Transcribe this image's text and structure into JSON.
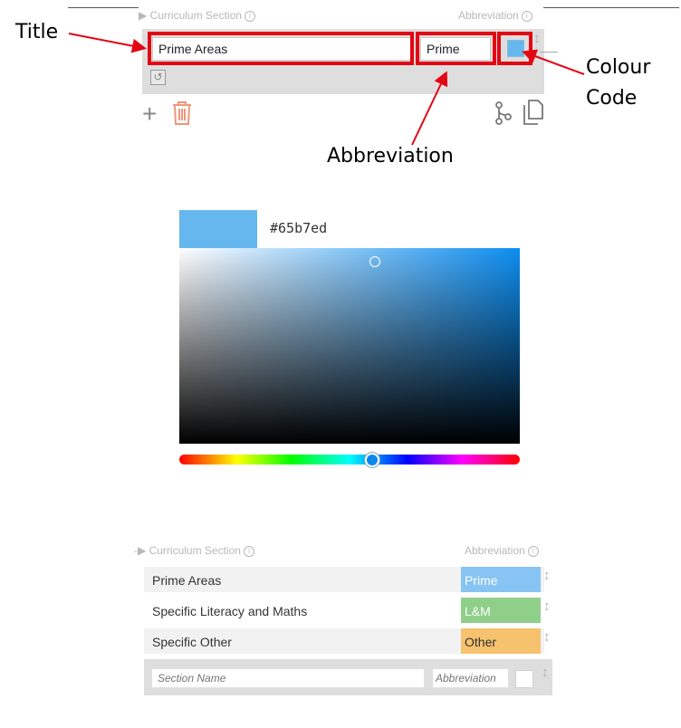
{
  "annotations": {
    "title": "Title",
    "abbreviation": "Abbreviation",
    "colour_code_line1": "Colour",
    "colour_code_line2": "Code"
  },
  "editor": {
    "section_header": "Curriculum Section",
    "abbr_header": "Abbreviation",
    "title_value": "Prime Areas",
    "abbr_value": "Prime",
    "colour": "#65b7ed"
  },
  "picker": {
    "hex": "#65b7ed",
    "hue_position": 0.57
  },
  "list": {
    "section_header": "Curriculum Section",
    "abbr_header": "Abbreviation",
    "rows": [
      {
        "name": "Prime Areas",
        "abbr": "Prime",
        "color": "#87c4f3",
        "text": "#ffffff"
      },
      {
        "name": "Specific Literacy and Maths",
        "abbr": "L&M",
        "color": "#8fcf8a",
        "text": "#ffffff"
      },
      {
        "name": "Specific Other",
        "abbr": "Other",
        "color": "#f6c26e",
        "text": "#333333"
      }
    ],
    "new_row": {
      "name_placeholder": "Section Name",
      "abbr_placeholder": "Abbreviation"
    }
  }
}
